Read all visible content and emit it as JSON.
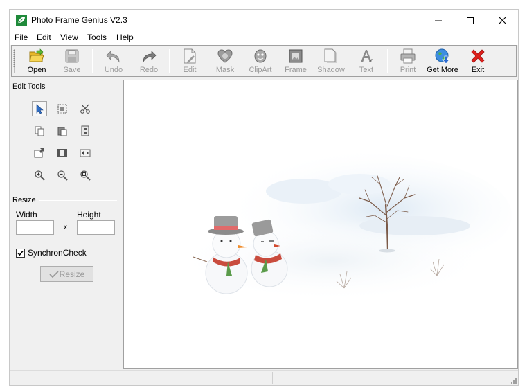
{
  "window": {
    "title": "Photo Frame Genius V2.3",
    "icon": "leaf-app-icon",
    "controls": [
      "minimize",
      "maximize",
      "close"
    ]
  },
  "menu": [
    "File",
    "Edit",
    "View",
    "Tools",
    "Help"
  ],
  "toolbar": {
    "open": "Open",
    "save": "Save",
    "undo": "Undo",
    "redo": "Redo",
    "edit": "Edit",
    "mask": "Mask",
    "clipart": "ClipArt",
    "frame": "Frame",
    "shadow": "Shadow",
    "text": "Text",
    "print": "Print",
    "get_more": "Get More",
    "exit": "Exit"
  },
  "edit_tools": {
    "title": "Edit Tools",
    "tools": [
      "select-arrow",
      "crop-select",
      "cut",
      "copy",
      "paste",
      "properties",
      "export",
      "film-frame",
      "flip",
      "zoom-in",
      "zoom-out",
      "zoom-fit"
    ]
  },
  "resize": {
    "title": "Resize",
    "width_label": "Width",
    "height_label": "Height",
    "width_value": "",
    "height_value": "",
    "separator": "x",
    "sync_label": "SynchronCheck",
    "sync_checked": true,
    "button_label": "Resize"
  },
  "canvas": {
    "image": "winter scene with two snowmen and bare tree"
  },
  "status": [
    "",
    "",
    ""
  ]
}
